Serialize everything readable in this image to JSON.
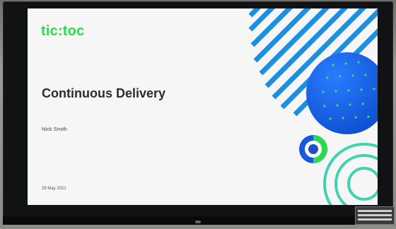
{
  "slide": {
    "brand": "tic:toc",
    "title": "Continuous Delivery",
    "presenter": "Nick Smith",
    "date": "28 May 2021"
  },
  "colors": {
    "brand_green": "#2fd94f",
    "stripe_blue": "#1d8fe0",
    "circle_blue": "#1466e6",
    "dot_green": "#2fd94f",
    "ring_teal": "#3fd3b0"
  },
  "icons": {
    "stripes": "diagonal-stripes",
    "dotted_circle": "dotted-circle",
    "target": "target-circle",
    "rings": "concentric-rings"
  }
}
